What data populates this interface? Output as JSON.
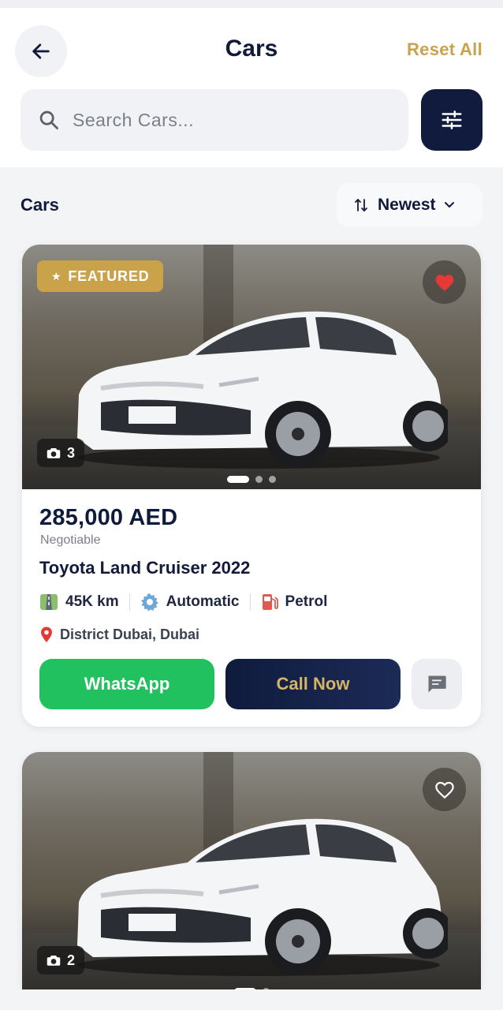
{
  "header": {
    "title": "Cars",
    "reset_label": "Reset All",
    "back_icon": "arrow-left-icon",
    "search_placeholder": "Search Cars...",
    "filter_icon": "sliders-icon"
  },
  "list": {
    "section_label": "Cars",
    "sort_label": "Newest"
  },
  "colors": {
    "navy": "#0f1b3d",
    "gold": "#c9a24a",
    "whatsapp_green": "#22c160",
    "favorite_red": "#e53935"
  },
  "cards": [
    {
      "featured": true,
      "featured_label": "FEATURED",
      "favorited": true,
      "photo_count": "3",
      "price": "285,000 AED",
      "negotiable": "Negotiable",
      "title": "Toyota Land Cruiser 2022",
      "mileage": "45K km",
      "transmission": "Automatic",
      "fuel": "Petrol",
      "location": "District Dubai, Dubai",
      "whatsapp_label": "WhatsApp",
      "call_label": "Call Now"
    },
    {
      "featured": false,
      "favorited": false,
      "photo_count": "2"
    }
  ]
}
